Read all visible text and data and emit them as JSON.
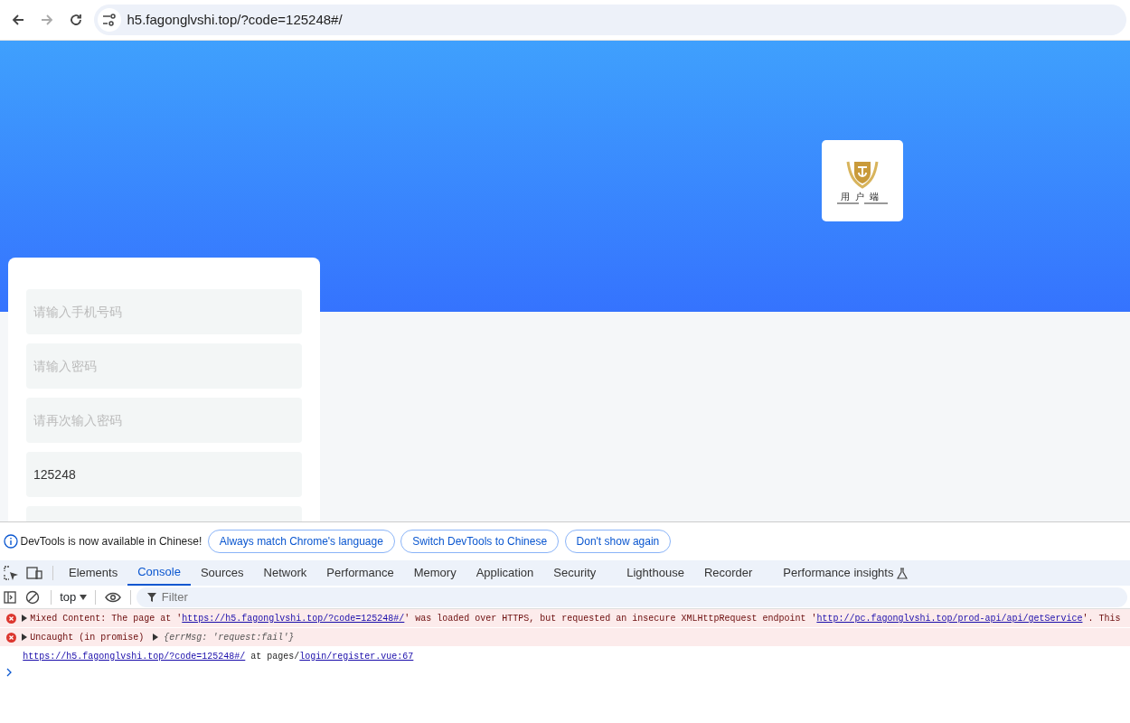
{
  "browser": {
    "url": "h5.fagonglvshi.top/?code=125248#/",
    "forward_disabled": true
  },
  "app": {
    "logo_text": "用户端",
    "fields": [
      {
        "kind": "input",
        "placeholder": "请输入手机号码"
      },
      {
        "kind": "input",
        "placeholder": "请输入密码"
      },
      {
        "kind": "input",
        "placeholder": "请再次输入密码"
      },
      {
        "kind": "input",
        "value": "125248"
      },
      {
        "kind": "input"
      }
    ]
  },
  "devtools": {
    "banner": {
      "message": "DevTools is now available in Chinese!",
      "buttons": [
        "Always match Chrome's language",
        "Switch DevTools to Chinese",
        "Don't show again"
      ]
    },
    "tabs": [
      {
        "label": "Elements",
        "selected": false
      },
      {
        "label": "Console",
        "selected": true
      },
      {
        "label": "Sources",
        "selected": false
      },
      {
        "label": "Network",
        "selected": false
      },
      {
        "label": "Performance",
        "selected": false
      },
      {
        "label": "Memory",
        "selected": false
      },
      {
        "label": "Application",
        "selected": false
      },
      {
        "label": "Security",
        "selected": false
      },
      {
        "label": "Lighthouse",
        "selected": false
      },
      {
        "label": "Recorder",
        "selected": false
      },
      {
        "label": "Performance insights",
        "selected": false,
        "experimental": true
      }
    ],
    "context": "top",
    "filter_placeholder": "Filter",
    "messages": [
      {
        "kind": "error",
        "parts": [
          {
            "text": "Mixed Content: The page at '"
          },
          {
            "link": "https://h5.fagonglvshi.top/?code=125248#/"
          },
          {
            "text": "' was loaded over HTTPS, but requested an insecure XMLHttpRequest endpoint '"
          },
          {
            "link": "http://pc.fagonglvshi.top/prod-api/api/getService"
          },
          {
            "text": "'. This"
          }
        ]
      },
      {
        "kind": "error",
        "parts": [
          {
            "text": "Uncaught (in promise) "
          },
          {
            "object": "{errMsg: 'request:fail'}"
          }
        ]
      },
      {
        "kind": "trace",
        "parts": [
          {
            "link": "https://h5.fagonglvshi.top/?code=125248#/"
          },
          {
            "text": "  at pages/"
          },
          {
            "link": "login/register.vue:67"
          }
        ]
      }
    ]
  }
}
